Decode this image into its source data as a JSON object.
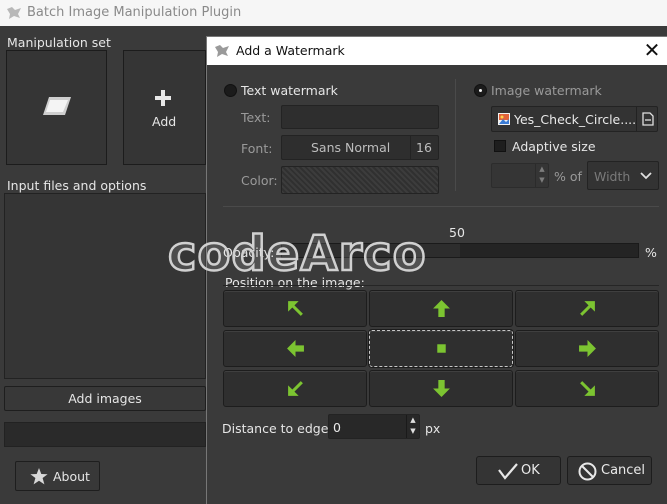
{
  "main_window": {
    "title": "Batch Image Manipulation Plugin",
    "manipulation_set_label": "Manipulation set",
    "add_tile_label": "Add",
    "input_files_label": "Input files and options",
    "add_images_label": "Add images",
    "about_label": "About"
  },
  "dialog": {
    "title": "Add a Watermark",
    "text_watermark": {
      "radio_label": "Text watermark",
      "selected": false,
      "text_label": "Text:",
      "text_value": "",
      "font_label": "Font:",
      "font_name": "Sans Normal",
      "font_size": "16",
      "color_label": "Color:"
    },
    "image_watermark": {
      "radio_label": "Image watermark",
      "selected": true,
      "file_name": "Yes_Check_Circle....",
      "adaptive_size_label": "Adaptive size",
      "adaptive_size_checked": false,
      "percent_label": "% of",
      "dimension_value": "Width"
    },
    "opacity": {
      "label": "Opacity:",
      "value": "50",
      "unit": "%"
    },
    "position": {
      "label": "Position on the image:",
      "selected": "center",
      "buttons": [
        {
          "name": "position-top-left",
          "icon": "arrow-up-left-icon"
        },
        {
          "name": "position-top",
          "icon": "arrow-up-icon"
        },
        {
          "name": "position-top-right",
          "icon": "arrow-up-right-icon"
        },
        {
          "name": "position-left",
          "icon": "arrow-left-icon"
        },
        {
          "name": "position-center",
          "icon": "square-icon"
        },
        {
          "name": "position-right",
          "icon": "arrow-right-icon"
        },
        {
          "name": "position-bottom-left",
          "icon": "arrow-down-left-icon"
        },
        {
          "name": "position-bottom",
          "icon": "arrow-down-icon"
        },
        {
          "name": "position-bottom-right",
          "icon": "arrow-down-right-icon"
        }
      ]
    },
    "distance": {
      "label": "Distance to edge:",
      "value": "0",
      "unit": "px"
    },
    "ok_label": "OK",
    "cancel_label": "Cancel"
  },
  "overlay_watermark": "codeArco",
  "colors": {
    "arrow_green": "#7cc431",
    "dialog_bg": "#3a3a3a",
    "field_bg": "#2e2e2e"
  }
}
